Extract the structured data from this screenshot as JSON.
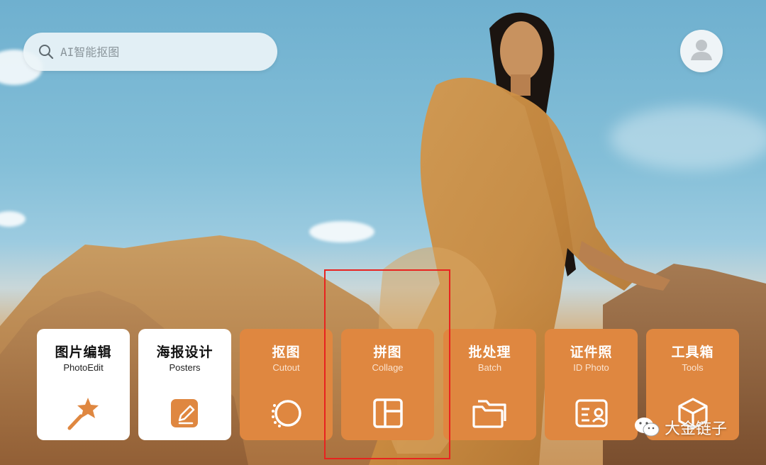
{
  "search": {
    "placeholder": "AI智能抠图"
  },
  "tiles": [
    {
      "title": "图片编辑",
      "subtitle": "PhotoEdit",
      "icon": "magic-wand-icon",
      "style": "white"
    },
    {
      "title": "海报设计",
      "subtitle": "Posters",
      "icon": "edit-pencil-icon",
      "style": "white"
    },
    {
      "title": "抠图",
      "subtitle": "Cutout",
      "icon": "cutout-circle-icon",
      "style": "orange"
    },
    {
      "title": "拼图",
      "subtitle": "Collage",
      "icon": "collage-layout-icon",
      "style": "orange"
    },
    {
      "title": "批处理",
      "subtitle": "Batch",
      "icon": "folders-icon",
      "style": "orange"
    },
    {
      "title": "证件照",
      "subtitle": "ID Photo",
      "icon": "id-card-icon",
      "style": "orange"
    },
    {
      "title": "工具箱",
      "subtitle": "Tools",
      "icon": "toolbox-cube-icon",
      "style": "orange"
    }
  ],
  "watermark": {
    "text": "大金链子"
  },
  "colors": {
    "accent_orange": "#df8740",
    "highlight_red": "#e8231f",
    "tile_white": "#ffffff"
  }
}
